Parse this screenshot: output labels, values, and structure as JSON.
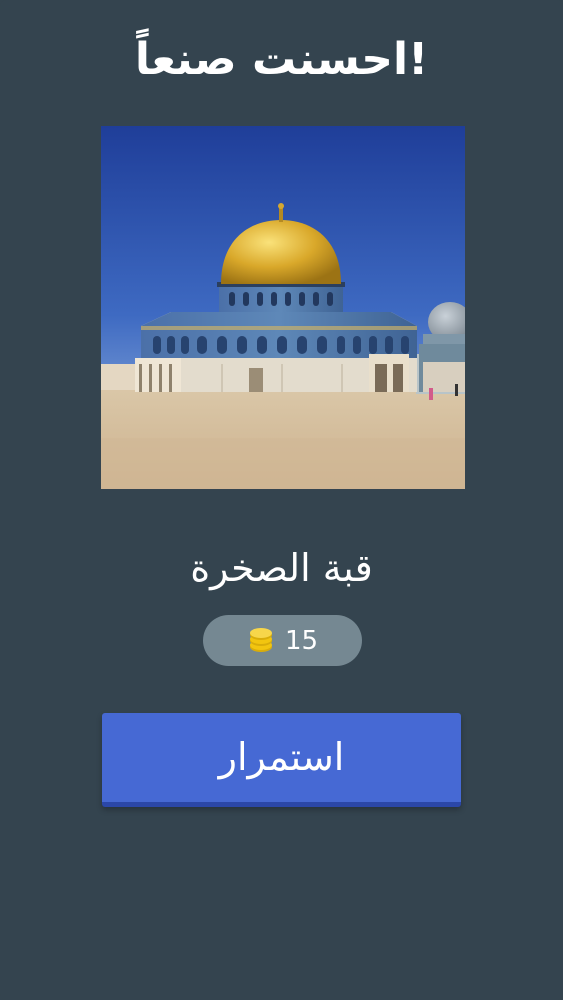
{
  "header": {
    "title": "!احسنت صنعاً"
  },
  "image": {
    "subject": "dome-of-the-rock-photo"
  },
  "answer": {
    "text": "قبة الصخرة"
  },
  "reward": {
    "coins": "15",
    "icon": "coin-stack-icon",
    "color": "#f2c50f"
  },
  "actions": {
    "continue_label": "استمرار"
  },
  "colors": {
    "background": "#34444f",
    "button": "#4669d4",
    "badge": "#758892"
  }
}
